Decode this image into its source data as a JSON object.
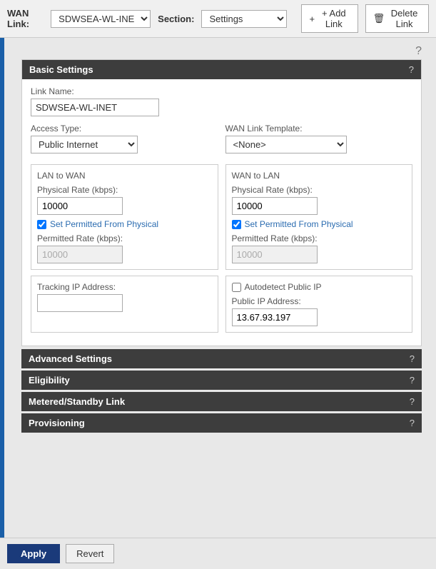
{
  "topBar": {
    "wanLinkLabel": "WAN Link:",
    "wanLinkValue": "SDWSEA-WL-INET",
    "sectionLabel": "Section:",
    "sectionValue": "Settings",
    "addLinkLabel": "+ Add Link",
    "deleteLinkLabel": "Delete Link"
  },
  "helpIcon": "?",
  "basicSettings": {
    "title": "Basic Settings",
    "helpQ": "?",
    "linkNameLabel": "Link Name:",
    "linkNameValue": "SDWSEA-WL-INET",
    "accessTypeLabel": "Access Type:",
    "accessTypeValue": "Public Internet",
    "wanTemplateLabel": "WAN Link Template:",
    "wanTemplateValue": "<None>",
    "lanToWan": {
      "title": "LAN to WAN",
      "physicalRateLabel": "Physical Rate (kbps):",
      "physicalRateValue": "10000",
      "checkboxLabel": "Set Permitted From Physical",
      "permittedRateLabel": "Permitted Rate (kbps):",
      "permittedRateValue": "10000"
    },
    "wanToLan": {
      "title": "WAN to LAN",
      "physicalRateLabel": "Physical Rate (kbps):",
      "physicalRateValue": "10000",
      "checkboxLabel": "Set Permitted From Physical",
      "permittedRateLabel": "Permitted Rate (kbps):",
      "permittedRateValue": "10000"
    },
    "trackingIPLabel": "Tracking IP Address:",
    "trackingIPValue": "",
    "autodetectLabel": "Autodetect Public IP",
    "publicIPLabel": "Public IP Address:",
    "publicIPValue": "13.67.93.197"
  },
  "advancedSettings": {
    "title": "Advanced Settings",
    "helpQ": "?"
  },
  "eligibility": {
    "title": "Eligibility",
    "helpQ": "?"
  },
  "meteredStandby": {
    "title": "Metered/Standby Link",
    "helpQ": "?"
  },
  "provisioning": {
    "title": "Provisioning",
    "helpQ": "?"
  },
  "bottomBar": {
    "applyLabel": "Apply",
    "revertLabel": "Revert"
  }
}
